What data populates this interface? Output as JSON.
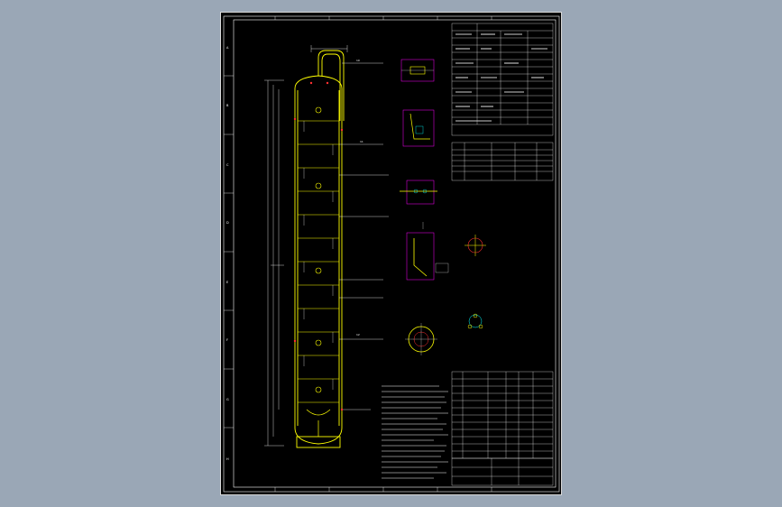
{
  "drawing": {
    "colors": {
      "background": "#9aa7b6",
      "sheet": "#000000",
      "frame": "#ffffff",
      "vessel": "#ffff00",
      "dimension": "#ffffff",
      "cyan": "#00ffff",
      "red": "#ff3030",
      "magenta": "#ff00ff"
    },
    "zone_letters": [
      "A",
      "B",
      "C",
      "D",
      "E",
      "F",
      "G",
      "H"
    ],
    "callouts": [
      "10",
      "11",
      "12"
    ]
  }
}
